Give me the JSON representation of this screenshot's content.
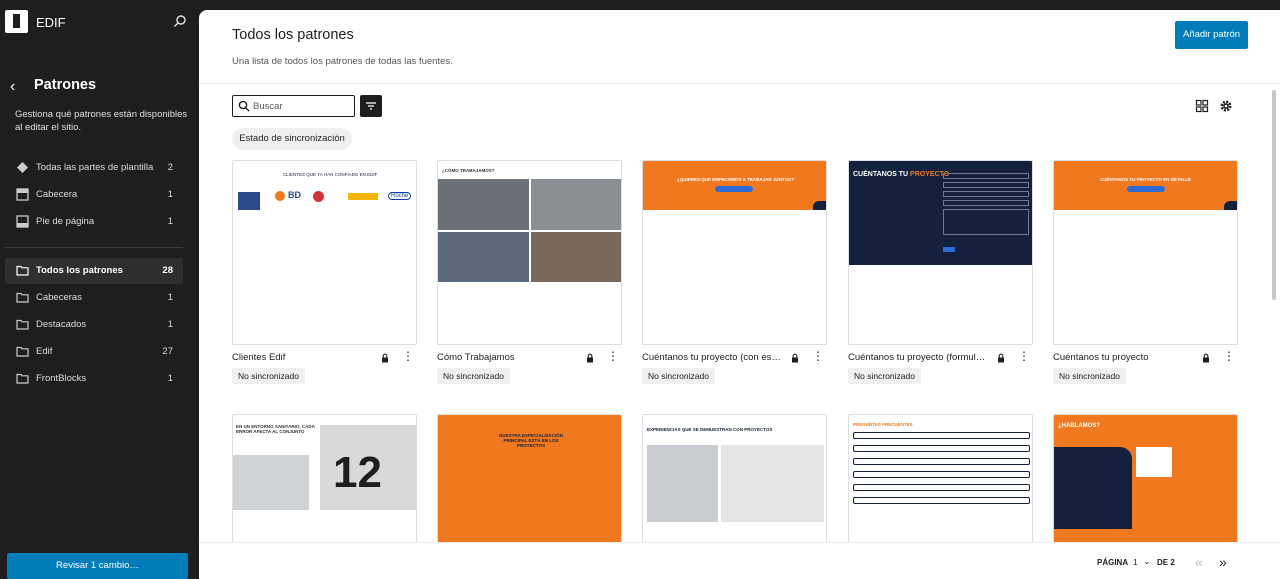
{
  "sidebar": {
    "site_name": "EDIF",
    "panel_title": "Patrones",
    "panel_description": "Gestiona qué patrones están disponibles al editar el sitio.",
    "template_parts": [
      {
        "label": "Todas las partes de plantilla",
        "count": "2",
        "icon": "template-parts-icon"
      },
      {
        "label": "Cabecera",
        "count": "1",
        "icon": "header-icon"
      },
      {
        "label": "Pie de página",
        "count": "1",
        "icon": "footer-icon"
      }
    ],
    "categories": [
      {
        "label": "Todos los patrones",
        "count": "28",
        "active": true
      },
      {
        "label": "Cabeceras",
        "count": "1"
      },
      {
        "label": "Destacados",
        "count": "1"
      },
      {
        "label": "Edif",
        "count": "27"
      },
      {
        "label": "FrontBlocks",
        "count": "1"
      }
    ],
    "review_button": "Revisar 1 cambio…"
  },
  "header": {
    "title": "Todos los patrones",
    "subtitle": "Una lista de todos los patrones de todas las fuentes.",
    "add_button": "Añadir patrón"
  },
  "toolbar": {
    "search_placeholder": "Buscar",
    "sync_filter": "Estado de sincronización"
  },
  "patterns": [
    {
      "title": "Clientes Edif",
      "status": "No sincronizado"
    },
    {
      "title": "Cómo Trabajamos",
      "status": "No sincronizado"
    },
    {
      "title": "Cuéntanos tu proyecto (con es…",
      "status": "No sincronizado"
    },
    {
      "title": "Cuéntanos tu proyecto (formul…",
      "status": "No sincronizado"
    },
    {
      "title": "Cuéntanos tu proyecto",
      "status": "No sincronizado"
    }
  ],
  "thumbs": {
    "clientes_heading": "CLIENTES QUE YA HAN CONFIADO EN EDIF",
    "clientes_logos": [
      "BD",
      "Roche"
    ],
    "como_heading": "¿CÓMO TRABAJAMOS?",
    "quieres_heading": "¿QUIERES QUE EMPECEMOS A TRABAJAR JUNTOS?",
    "cuentanos_heading": "CUÉNTANOS TU",
    "cuentanos_highlight": "PROYECTO",
    "cuentanos_detalle": "CUÉNTANOS TU PROYECTO EN DETALLE",
    "entorno_heading": "EN UN ENTORNO SANITARIO, CADA ERROR AFECTA AL CONJUNTO",
    "especializacion_heading": "NUESTRA ESPECIALIZACIÓN PRINCIPAL ESTÁ EN LOS PROYECTOS",
    "experiencias_heading": "EXPERIENCIAS QUE SE DEMUESTRAN CON PROYECTOS",
    "preguntas_heading": "PREGUNTAS FRECUENTES",
    "hablamos_heading": "¿HABLAMOS?",
    "big_number": "12"
  },
  "pagination": {
    "label": "PÁGINA",
    "current": "1",
    "of_label": "DE 2",
    "prev": "«",
    "next": "»"
  },
  "colors": {
    "accent": "#007cba",
    "orange": "#f0781e",
    "navy": "#14213d",
    "sidebar_bg": "#1e1e1e"
  }
}
